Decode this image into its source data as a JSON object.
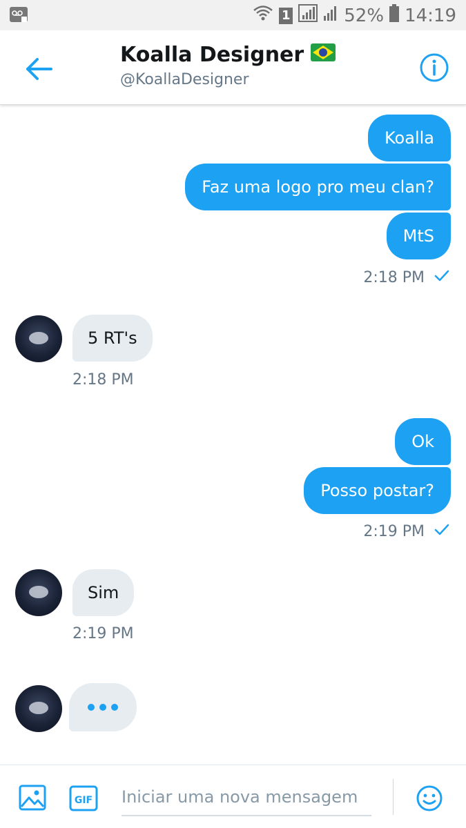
{
  "status_bar": {
    "battery_percent": "52%",
    "time": "14:19",
    "sim_badge": "1"
  },
  "header": {
    "name": "Koalla Designer",
    "flag": "🇧🇷",
    "handle": "@KoallaDesigner"
  },
  "messages": {
    "group1": [
      "Koalla",
      "Faz uma logo pro meu clan?",
      "MtS"
    ],
    "group1_time": "2:18 PM",
    "reply1": "5 RT's",
    "reply1_time": "2:18 PM",
    "group2": [
      "Ok",
      "Posso postar?"
    ],
    "group2_time": "2:19 PM",
    "reply2": "Sim",
    "reply2_time": "2:19 PM"
  },
  "composer": {
    "placeholder": "Iniciar uma nova mensagem",
    "gif_label": "GIF"
  },
  "colors": {
    "accent": "#1da1f2",
    "incoming_bubble": "#e6ecf0"
  }
}
